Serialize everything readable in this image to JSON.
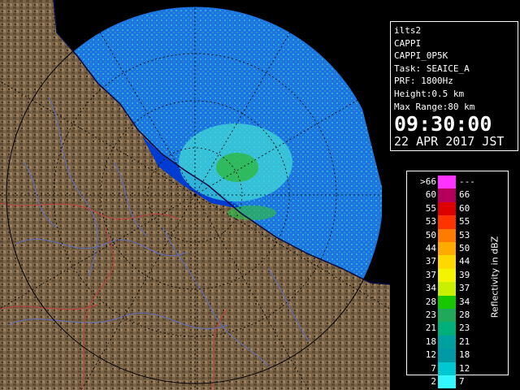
{
  "info": {
    "station": "ilts2",
    "product": "CAPPI",
    "product_name": "CAPPI_0P5K",
    "task": "Task: SEAICE_A",
    "prf": "PRF: 1800Hz",
    "height": "Height:0.5 km",
    "max_range": "Max Range:80 km",
    "time": "09:30:00",
    "date": "22 APR 2017 JST"
  },
  "legend": {
    "title": "Reflectivity in dBZ",
    "rows": [
      {
        "low": ">66",
        "high": "---",
        "color": "#ff33ff"
      },
      {
        "low": "60",
        "high": "66",
        "color": "#b4005a"
      },
      {
        "low": "55",
        "high": "60",
        "color": "#dd0000"
      },
      {
        "low": "53",
        "high": "55",
        "color": "#ff3300"
      },
      {
        "low": "50",
        "high": "53",
        "color": "#ff7a00"
      },
      {
        "low": "44",
        "high": "50",
        "color": "#ffaa00"
      },
      {
        "low": "37",
        "high": "44",
        "color": "#ffd800"
      },
      {
        "low": "37",
        "high": "39",
        "color": "#f4f400"
      },
      {
        "low": "34",
        "high": "37",
        "color": "#c8f000"
      },
      {
        "low": "28",
        "high": "34",
        "color": "#17c800"
      },
      {
        "low": "23",
        "high": "28",
        "color": "#22a85a"
      },
      {
        "low": "21",
        "high": "23",
        "color": "#00b07a"
      },
      {
        "low": "18",
        "high": "21",
        "color": "#00a0a0"
      },
      {
        "low": "12",
        "high": "18",
        "color": "#009aa6"
      },
      {
        "low": "7",
        "high": "12",
        "color": "#00c8d2"
      },
      {
        "low": "2",
        "high": "7",
        "color": "#33f6ff"
      }
    ]
  },
  "map": {
    "radar_center": [
      240,
      240
    ],
    "range_km": 80,
    "colors": {
      "sea": "#1d73e0",
      "inner_sea": "#003cd2",
      "land": "#7a6448",
      "land_dark": "#4a3a28",
      "echo_light": "#40d8d8",
      "echo_green": "#2fb84a",
      "river": "#6070c0",
      "boundary": "#c04040",
      "grid": "#000000"
    }
  }
}
